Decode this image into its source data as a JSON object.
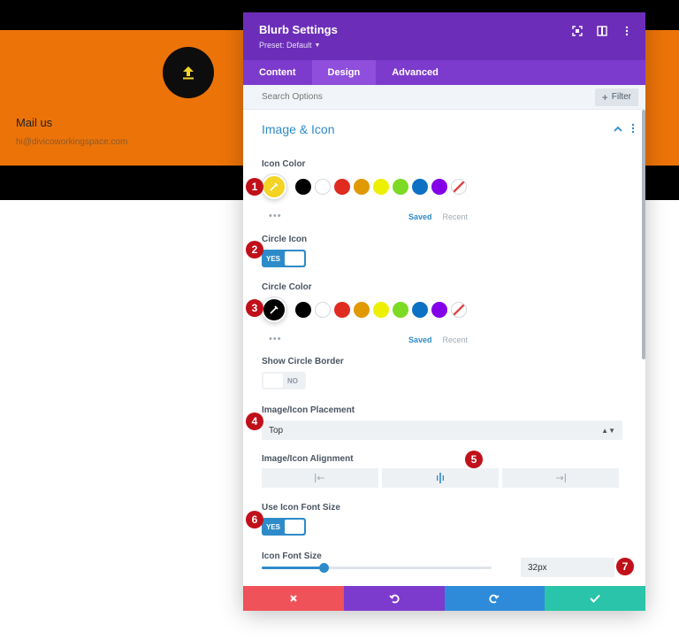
{
  "background": {
    "mail_title": "Mail us",
    "mail_email": "hi@divicoworkingspace.com",
    "icon": "upload-icon"
  },
  "modal": {
    "title": "Blurb Settings",
    "preset": "Preset: Default",
    "tabs": [
      "Content",
      "Design",
      "Advanced"
    ],
    "active_tab": "Design",
    "search_placeholder": "Search Options",
    "filter_label": "Filter",
    "section_title": "Image & Icon",
    "icon_color": {
      "label": "Icon Color",
      "selected": "#f3d325",
      "swatches": [
        "#000000",
        "#ffffff",
        "#e02b20",
        "#e09900",
        "#edf000",
        "#7cda24",
        "#0c71c3",
        "#8300e9",
        "none"
      ],
      "saved": "Saved",
      "recent": "Recent"
    },
    "circle_icon": {
      "label": "Circle Icon",
      "value": "YES",
      "on": true
    },
    "circle_color": {
      "label": "Circle Color",
      "selected": "#000000",
      "swatches": [
        "#000000",
        "#ffffff",
        "#e02b20",
        "#e09900",
        "#edf000",
        "#7cda24",
        "#0c71c3",
        "#8300e9",
        "none"
      ],
      "saved": "Saved",
      "recent": "Recent"
    },
    "show_circle_border": {
      "label": "Show Circle Border",
      "value": "NO",
      "on": false
    },
    "placement": {
      "label": "Image/Icon Placement",
      "value": "Top"
    },
    "alignment": {
      "label": "Image/Icon Alignment",
      "options": [
        "left",
        "center",
        "right"
      ],
      "selected": "center"
    },
    "use_icon_font_size": {
      "label": "Use Icon Font Size",
      "value": "YES",
      "on": true
    },
    "icon_font_size": {
      "label": "Icon Font Size",
      "value": "32px",
      "slider_fraction": 0.27
    },
    "footer_buttons": [
      "discard",
      "undo",
      "redo",
      "save"
    ]
  },
  "badges": [
    "1",
    "2",
    "3",
    "4",
    "5",
    "6",
    "7"
  ]
}
